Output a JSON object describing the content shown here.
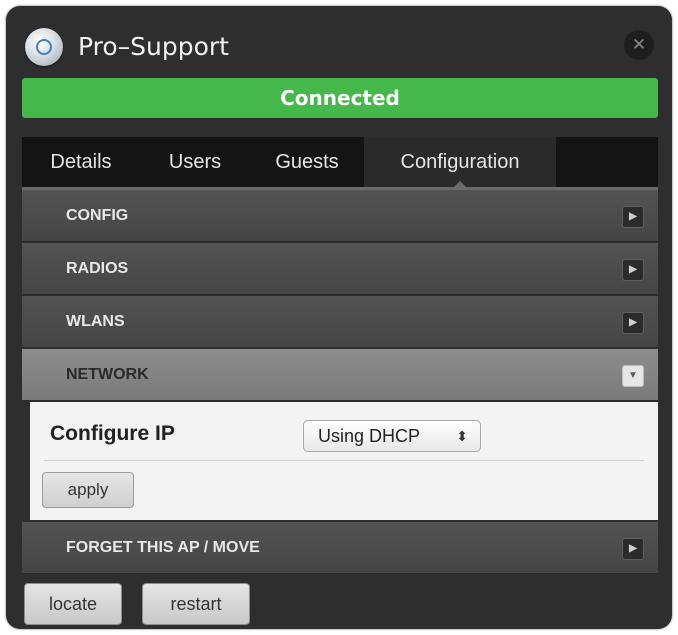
{
  "window": {
    "title": "Pro–Support",
    "close_glyph": "✕"
  },
  "status": {
    "text": "Connected",
    "color": "#44b84a"
  },
  "tabs": [
    {
      "label": "Details",
      "active": false
    },
    {
      "label": "Users",
      "active": false
    },
    {
      "label": "Guests",
      "active": false
    },
    {
      "label": "Configuration",
      "active": true
    }
  ],
  "sections": [
    {
      "label": "CONFIG",
      "expanded": false,
      "icon": "chevron-right-icon"
    },
    {
      "label": "RADIOS",
      "expanded": false,
      "icon": "chevron-right-icon"
    },
    {
      "label": "WLANS",
      "expanded": false,
      "icon": "chevron-right-icon"
    },
    {
      "label": "NETWORK",
      "expanded": true,
      "icon": "chevron-down-icon"
    },
    {
      "label": "FORGET THIS AP / MOVE",
      "expanded": false,
      "icon": "chevron-right-icon"
    }
  ],
  "network_panel": {
    "configure_ip_label": "Configure IP",
    "configure_ip_value": "Using DHCP",
    "apply_label": "apply"
  },
  "footer": {
    "locate_label": "locate",
    "restart_label": "restart"
  }
}
